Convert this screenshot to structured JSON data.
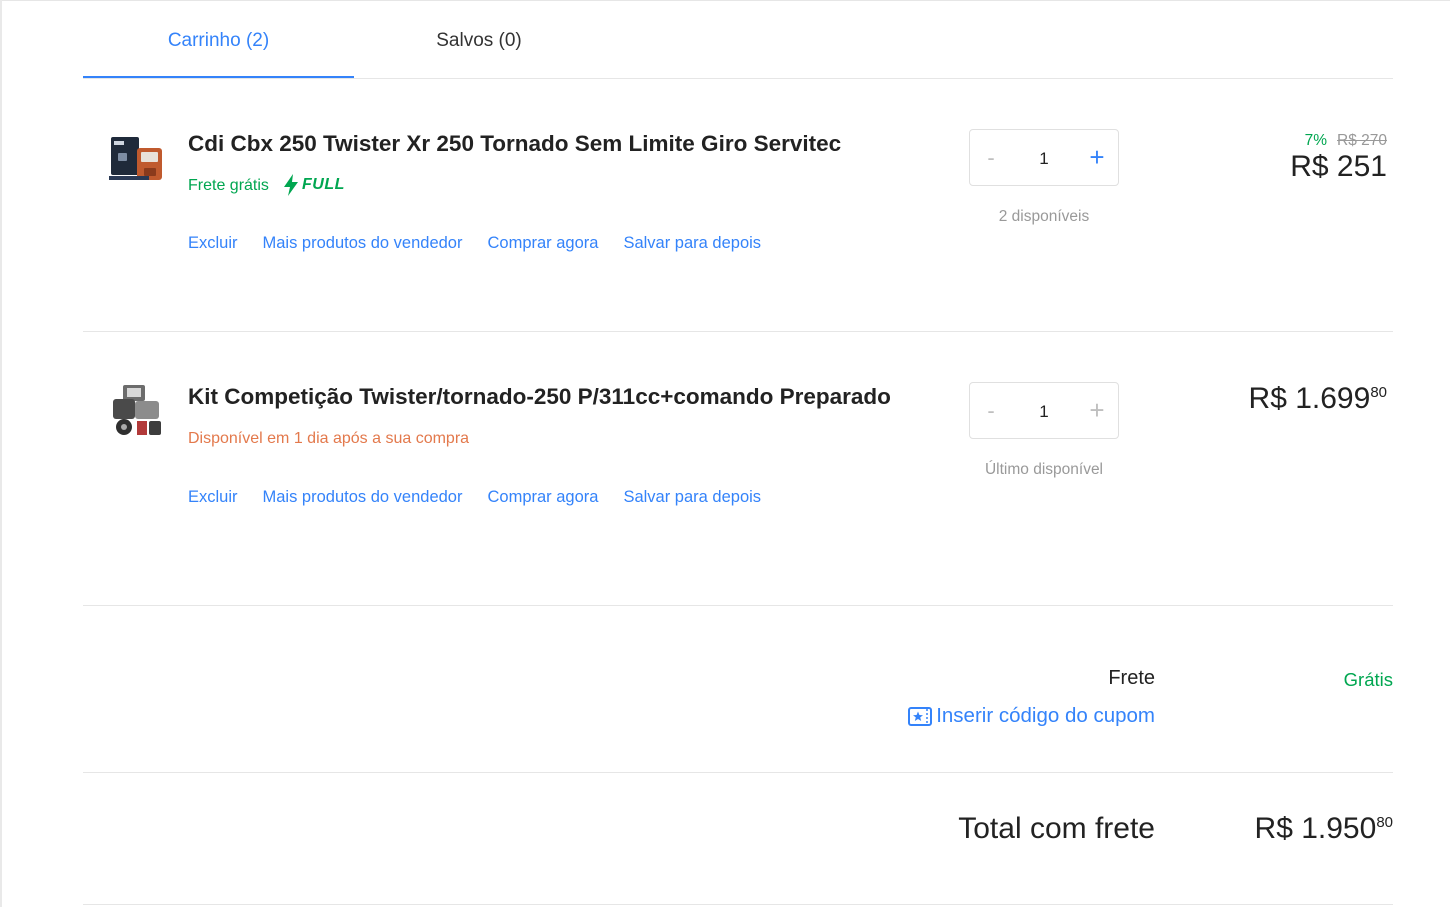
{
  "tabs": [
    {
      "label": "Carrinho (2)",
      "active": true
    },
    {
      "label": "Salvos (0)",
      "active": false
    }
  ],
  "items": [
    {
      "title": "Cdi Cbx 250 Twister Xr 250 Tornado Sem Limite Giro Servitec",
      "shipping": "Frete grátis",
      "shipping_badge": "FULL",
      "actions": [
        "Excluir",
        "Mais produtos do vendedor",
        "Comprar agora",
        "Salvar para depois"
      ],
      "quantity": "1",
      "qty_minus": "-",
      "qty_plus": "+",
      "availability": "2 disponíveis",
      "discount_pct": "7%",
      "old_price": "R$ 270",
      "price_main": "R$ 251",
      "price_cents": ""
    },
    {
      "title": "Kit Competição Twister/tornado-250 P/311cc+comando Preparado",
      "shipping": "Disponível em 1 dia após a sua compra",
      "actions": [
        "Excluir",
        "Mais produtos do vendedor",
        "Comprar agora",
        "Salvar para depois"
      ],
      "quantity": "1",
      "qty_minus": "-",
      "qty_plus": "+",
      "availability": "Último disponível",
      "price_main": "R$ 1.699",
      "price_cents": "80"
    }
  ],
  "summary": {
    "shipping_label": "Frete",
    "shipping_value": "Grátis",
    "coupon_label": "Inserir código do cupom",
    "total_label": "Total com frete",
    "total_main": "R$ 1.950",
    "total_cents": "80"
  },
  "colors": {
    "accent": "#3483fa",
    "green": "#00a650",
    "orange": "#e3794c"
  }
}
